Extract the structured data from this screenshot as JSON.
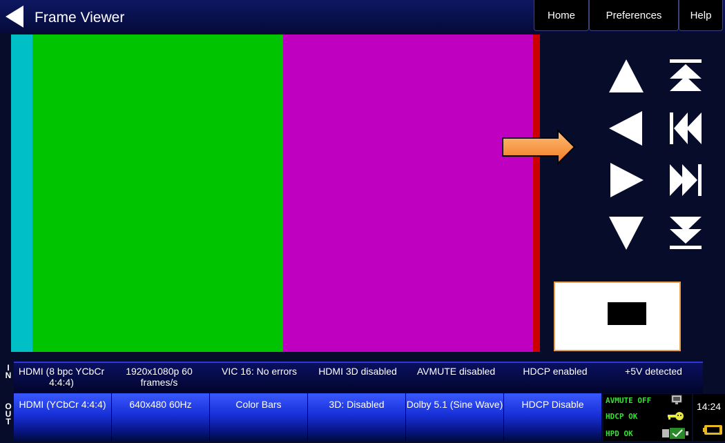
{
  "header": {
    "title": "Frame Viewer",
    "tabs": [
      "Home",
      "Preferences",
      "Help"
    ]
  },
  "frame": {
    "bands": [
      {
        "color": "#00bfc6"
      },
      {
        "color": "#00c400"
      },
      {
        "color": "#c000c0"
      },
      {
        "color": "#cc0000"
      }
    ]
  },
  "nav": [
    "up-arrow-icon",
    "top-icon",
    "left-arrow-icon",
    "first-icon",
    "right-arrow-icon",
    "last-icon",
    "down-arrow-icon",
    "bottom-icon"
  ],
  "status": {
    "in_label": "IN",
    "out_label": "OUT",
    "in": [
      "HDMI (8 bpc YCbCr 4:4:4)",
      "1920x1080p 60 frames/s",
      "VIC 16: No errors",
      "HDMI 3D disabled",
      "AVMUTE disabled",
      "HDCP enabled",
      "+5V detected"
    ],
    "out": [
      "HDMI (YCbCr 4:4:4)",
      "640x480 60Hz",
      "Color Bars",
      "3D: Disabled",
      "Dolby 5.1 (Sine Wave)",
      "HDCP Disable"
    ],
    "indicators": {
      "avmute": "AVMUTE OFF",
      "hdcp": "HDCP OK",
      "hpd": "HPD OK"
    },
    "time": "14:24"
  }
}
